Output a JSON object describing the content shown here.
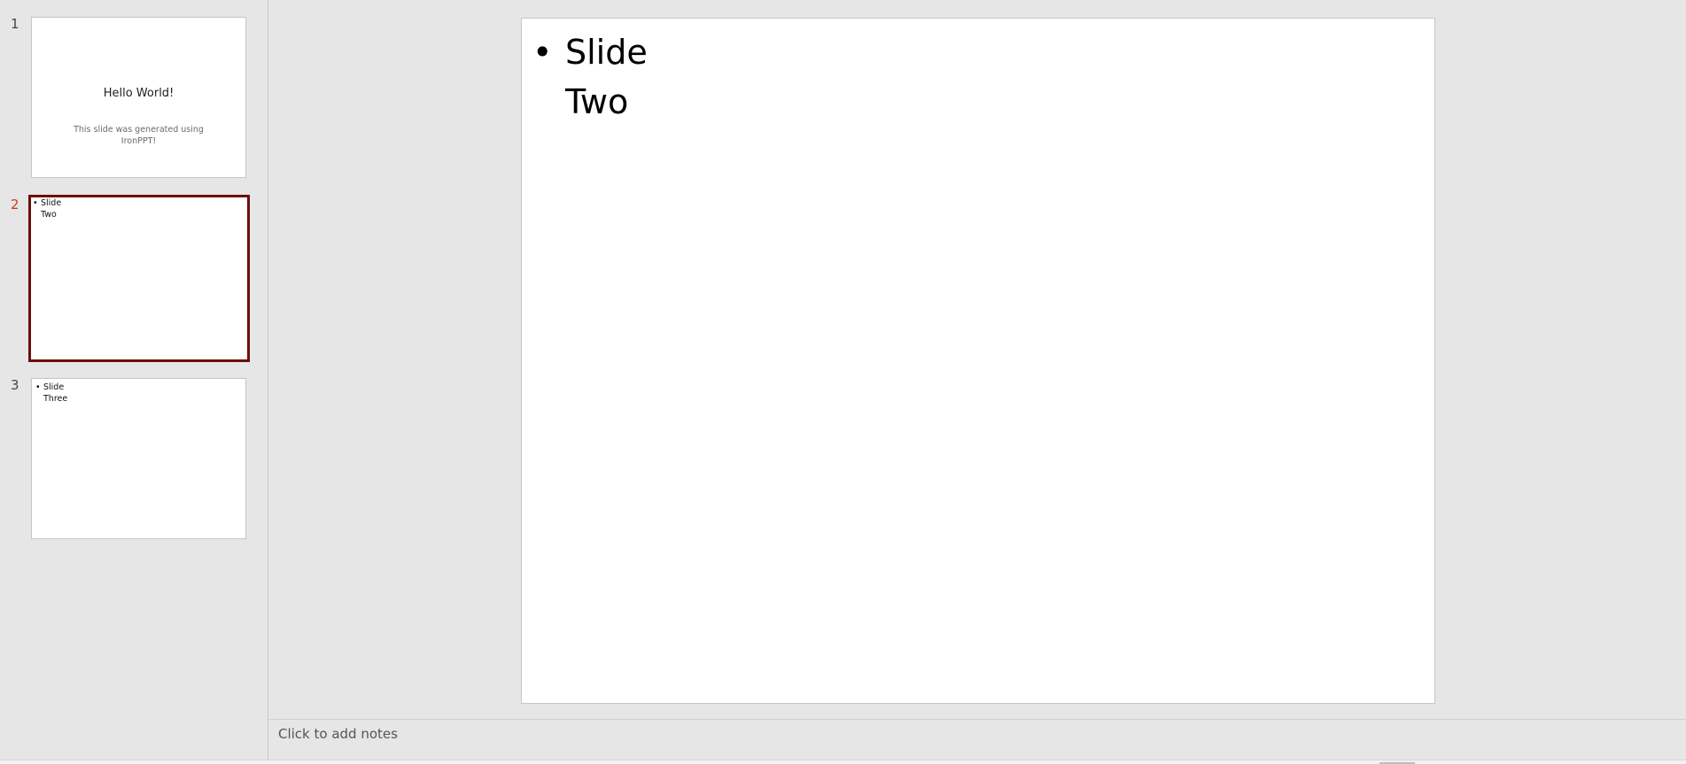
{
  "thumbnails": [
    {
      "number": "1",
      "title": "Hello World!",
      "subtitle": "This slide was generated using IronPPT!",
      "selected": false
    },
    {
      "number": "2",
      "bullet": "•",
      "text": "Slide Two",
      "selected": true
    },
    {
      "number": "3",
      "bullet": "•",
      "text": "Slide Three",
      "selected": false
    }
  ],
  "current_slide": {
    "bullet": "•",
    "text": "Slide Two"
  },
  "notes": {
    "placeholder": "Click to add notes"
  },
  "colors": {
    "selected_border": "#6e0d0d",
    "selected_number": "#c43e1c",
    "background": "#e6e6e6"
  }
}
